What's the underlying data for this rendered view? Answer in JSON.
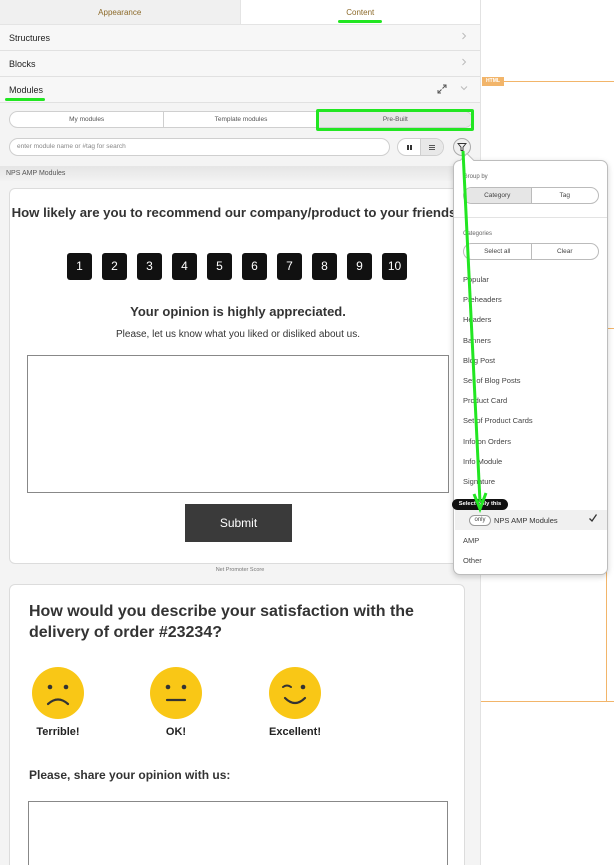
{
  "tabs": {
    "appearance": "Appearance",
    "content": "Content"
  },
  "accordion": {
    "structures": "Structures",
    "blocks": "Blocks",
    "modules": "Modules"
  },
  "module_tabs": [
    "My modules",
    "Template modules",
    "Pre-Built"
  ],
  "search": {
    "placeholder": "enter module name or #tag for search"
  },
  "section_title": "NPS AMP Modules",
  "canvas": {
    "html_badge": "HTML"
  },
  "nps_card": {
    "question": "How likely are you to recommend our company/product to your friends?",
    "numbers": [
      "1",
      "2",
      "3",
      "4",
      "5",
      "6",
      "7",
      "8",
      "9",
      "10"
    ],
    "appreciated": "Your opinion is highly appreciated.",
    "prompt": "Please, let us know what you liked or disliked about us.",
    "submit": "Submit"
  },
  "caption": "Net Promoter Score",
  "sat_card": {
    "question": "How would you describe your satisfaction with the delivery of order #23234?",
    "labels": [
      "Terrible!",
      "OK!",
      "Excellent!"
    ],
    "share": "Please, share your opinion with us:"
  },
  "dropdown": {
    "group_by_label": "Group by",
    "group_by_options": [
      "Category",
      "Tag"
    ],
    "categories_label": "Categories",
    "select_all": "Select all",
    "clear": "Clear",
    "categories": [
      "Popular",
      "Preheaders",
      "Headers",
      "Banners",
      "Blog Post",
      "Set of Blog Posts",
      "Product Card",
      "Set of Product Cards",
      "Info on Orders",
      "Info Module",
      "Signature"
    ],
    "selected_category": "NPS AMP Modules",
    "only_label": "only",
    "after": [
      "AMP",
      "Other"
    ],
    "tooltip": "Select only this"
  },
  "colors": {
    "highlight": "#22e622",
    "accent_orange": "#f2b56a",
    "emoji_yellow": "#f9c716",
    "button_dark": "#3a3a3a"
  }
}
